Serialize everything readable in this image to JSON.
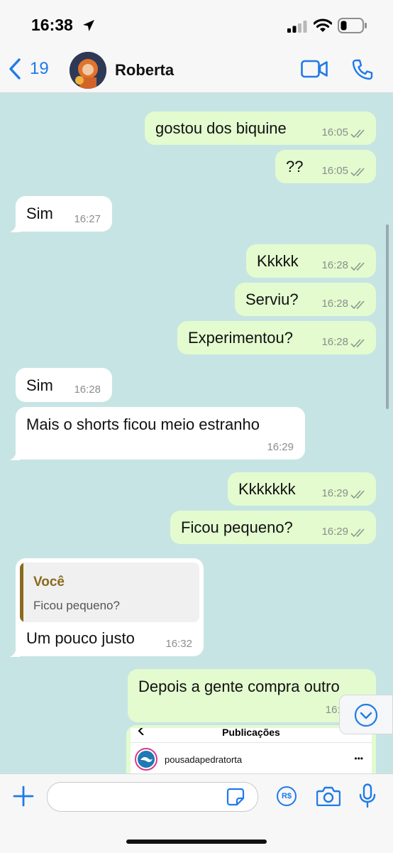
{
  "status_bar": {
    "time": "16:38",
    "icons": [
      "location-arrow-icon",
      "signal-icon",
      "wifi-icon",
      "battery-icon"
    ]
  },
  "header": {
    "back_count": "19",
    "contact_name": "Roberta",
    "icons": [
      "back-chevron-icon",
      "video-call-icon",
      "phone-call-icon"
    ]
  },
  "messages": [
    {
      "dir": "out",
      "text": "gostou dos biquine",
      "time": "16:05",
      "status": "read"
    },
    {
      "dir": "out",
      "text": "??",
      "time": "16:05",
      "status": "read"
    },
    {
      "dir": "in",
      "text": "Sim",
      "time": "16:27"
    },
    {
      "dir": "out",
      "text": "Kkkkk",
      "time": "16:28",
      "status": "read"
    },
    {
      "dir": "out",
      "text": "Serviu?",
      "time": "16:28",
      "status": "read"
    },
    {
      "dir": "out",
      "text": "Experimentou?",
      "time": "16:28",
      "status": "read"
    },
    {
      "dir": "in",
      "text": "Sim",
      "time": "16:28"
    },
    {
      "dir": "in",
      "text": "Mais o shorts ficou meio estranho",
      "time": "16:29"
    },
    {
      "dir": "out",
      "text": "Kkkkkkk",
      "time": "16:29",
      "status": "read"
    },
    {
      "dir": "out",
      "text": "Ficou pequeno?",
      "time": "16:29",
      "status": "read"
    },
    {
      "dir": "in",
      "text": "Um pouco justo",
      "time": "16:32",
      "reply": {
        "author": "Você",
        "text": "Ficou pequeno?"
      }
    },
    {
      "dir": "out",
      "text": "Depois a gente compra outro",
      "time": "16:3"
    }
  ],
  "shared_post": {
    "header": "Publicações",
    "account": "pousadapedratorta",
    "more": "•••"
  },
  "input_bar": {
    "icons": [
      "plus-icon",
      "sticker-icon",
      "payment-icon",
      "camera-icon",
      "microphone-icon"
    ],
    "payment_label": "R$"
  },
  "colors": {
    "accent": "#1f7aea",
    "chat_background": "#c7e4e4",
    "outgoing_bubble": "#e3fbcf",
    "incoming_bubble": "#ffffff",
    "reply_author": "#8a6a1c"
  }
}
